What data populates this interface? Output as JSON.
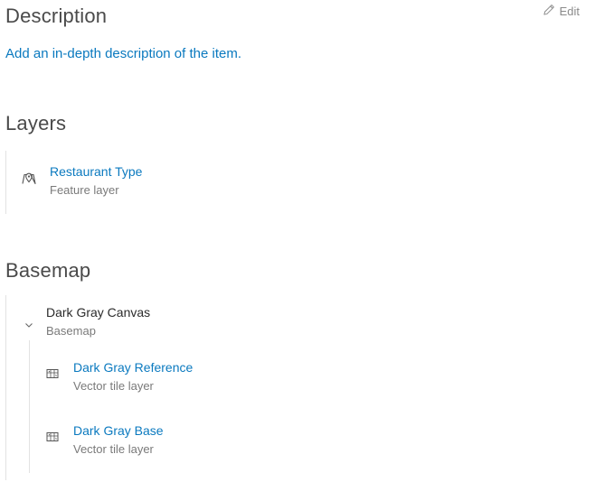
{
  "description": {
    "title": "Description",
    "edit_label": "Edit",
    "link": "Add an in-depth description of the item."
  },
  "layers": {
    "title": "Layers",
    "items": [
      {
        "name": "Restaurant Type",
        "type": "Feature layer",
        "icon": "feature-layer-icon"
      }
    ]
  },
  "basemap": {
    "title": "Basemap",
    "name": "Dark Gray Canvas",
    "type": "Basemap",
    "items": [
      {
        "name": "Dark Gray Reference",
        "type": "Vector tile layer",
        "icon": "vector-tile-layer-icon"
      },
      {
        "name": "Dark Gray Base",
        "type": "Vector tile layer",
        "icon": "vector-tile-layer-icon"
      }
    ]
  },
  "colors": {
    "link": "#0a79bf",
    "text": "#4a4a4a",
    "muted": "#7a7a7a"
  }
}
